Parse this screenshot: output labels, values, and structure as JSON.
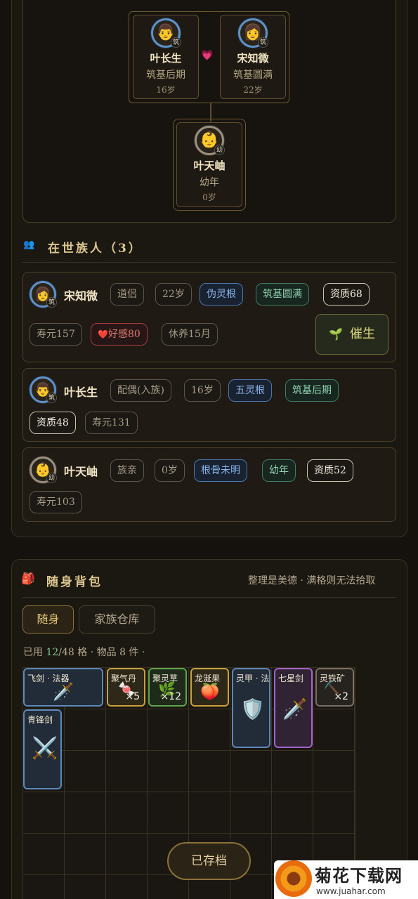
{
  "family_tree": {
    "father": {
      "avatar": "👨",
      "badge": "筑",
      "name": "叶长生",
      "stage": "筑基后期",
      "age": "16岁"
    },
    "heart": "💗",
    "mother": {
      "avatar": "👩",
      "badge": "筑",
      "name": "宋知微",
      "stage": "筑基圆满",
      "age": "22岁"
    },
    "child": {
      "avatar": "👶",
      "badge": "幼",
      "name": "叶天岫",
      "stage": "幼年",
      "age": "0岁"
    }
  },
  "members": {
    "icon": "people-icon",
    "icon_glyph": "👥",
    "title": "在世族人（3）",
    "list": [
      {
        "avatar": "👩",
        "badge": "筑",
        "name": "宋知微",
        "tags": [
          "道侣",
          "22岁",
          "伪灵根",
          "筑基圆满",
          "资质68",
          "寿元157",
          "好感80",
          "休养15月"
        ],
        "heart_glyph": "❤️",
        "action_icon": "🌱",
        "action": "催生"
      },
      {
        "avatar": "👨",
        "badge": "筑",
        "name": "叶长生",
        "tags": [
          "配偶(入族)",
          "16岁",
          "五灵根",
          "筑基后期",
          "资质48",
          "寿元131"
        ]
      },
      {
        "avatar": "👶",
        "badge": "幼",
        "name": "叶天岫",
        "tags": [
          "族亲",
          "0岁",
          "根骨未明",
          "幼年",
          "资质52",
          "寿元103"
        ]
      }
    ]
  },
  "bag": {
    "icon": "backpack-icon",
    "icon_glyph": "🎒",
    "title": "随身背包",
    "hint": "整理是美德 · 满格则无法拾取",
    "tabs": [
      "随身",
      "家族仓库"
    ],
    "stats": {
      "used_label": "已用",
      "used": "12",
      "capacity": "/48 格 · 物品 8 件 ·"
    },
    "items": [
      {
        "name": "飞剑 · 法器",
        "glyph": "🗡️",
        "rarity": "blue",
        "count": ""
      },
      {
        "name": "聚气丹",
        "glyph": "🍬",
        "rarity": "gold",
        "count": "×5"
      },
      {
        "name": "聚灵草",
        "glyph": "🌿",
        "rarity": "green",
        "count": "×12"
      },
      {
        "name": "龙涎果",
        "glyph": "🍑",
        "rarity": "gold",
        "count": ""
      },
      {
        "name": "灵甲 · 法",
        "glyph": "🛡️",
        "rarity": "blue",
        "count": ""
      },
      {
        "name": "七星剑",
        "glyph": "🗡️",
        "rarity": "purple",
        "count": ""
      },
      {
        "name": "灵铁矿",
        "glyph": "⛏️",
        "rarity": "gray",
        "count": "×2"
      },
      {
        "name": "青锋剑",
        "glyph": "⚔️",
        "rarity": "blue",
        "count": ""
      }
    ],
    "saved_button": "已存档"
  },
  "watermark": {
    "title": "菊花下载网",
    "url": "www.juahar.com"
  },
  "colors": {
    "background": "#15120d",
    "accent_gold": "#dcc78f",
    "rarity_blue": "#5b88b8",
    "rarity_gold": "#c8a03c",
    "rarity_green": "#5ea44f",
    "rarity_purple": "#a662c9",
    "rarity_gray": "#777065"
  }
}
